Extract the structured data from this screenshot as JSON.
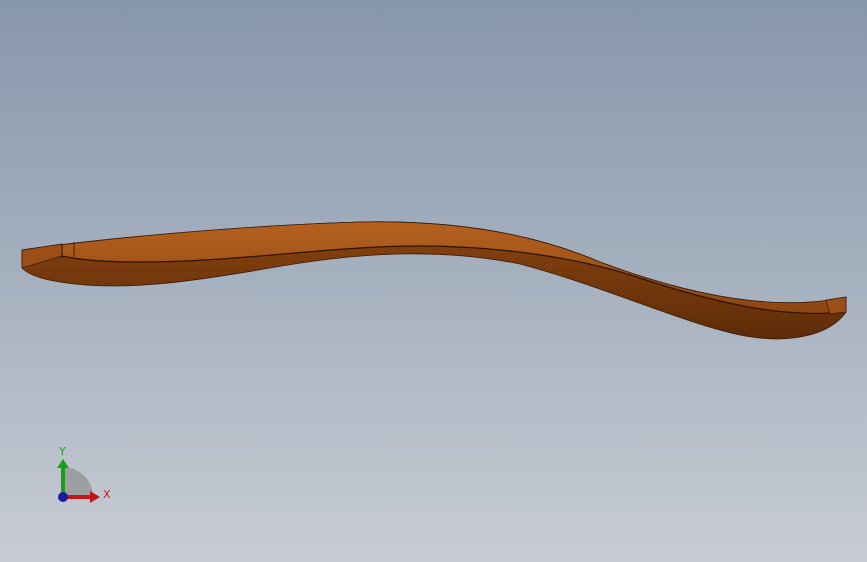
{
  "viewport": {
    "background_top": "#8797ab",
    "background_bottom": "#c8ccd4"
  },
  "model": {
    "body_color": "#7a3a0c",
    "top_face_color": "#a0521a",
    "edge_color": "#3b1a05"
  },
  "triad": {
    "x_label": "X",
    "y_label": "Y",
    "x_color": "#c01818",
    "y_color": "#18a018",
    "z_color": "#1a1aa0"
  }
}
